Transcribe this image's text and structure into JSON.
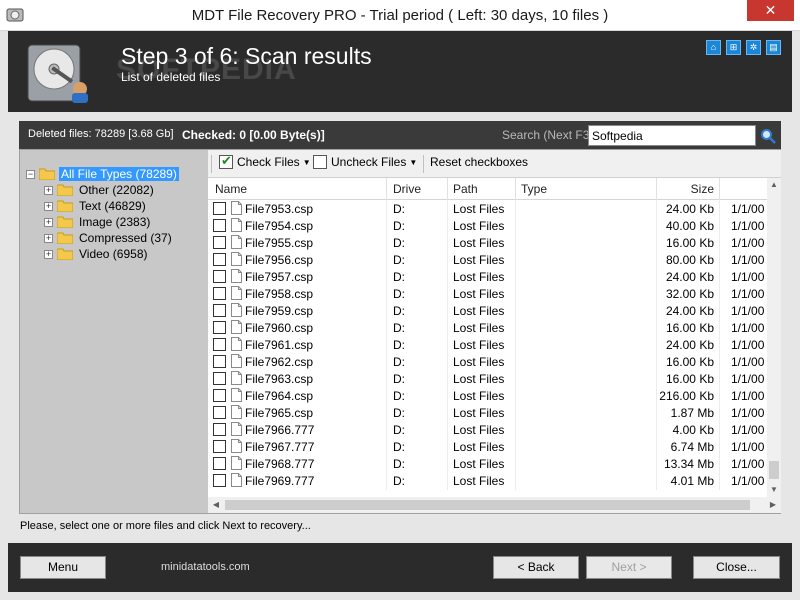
{
  "window": {
    "title": "MDT File Recovery PRO - Trial period ( Left: 30 days, 10 files )",
    "close_glyph": "✕"
  },
  "header": {
    "step": "Step 3 of 6: Scan results",
    "subtitle": "List of deleted files",
    "watermark": "SOFTPEDIA",
    "buttons": [
      {
        "icon": "home-icon",
        "glyph": "⌂"
      },
      {
        "icon": "sitemap-icon",
        "glyph": "⊞"
      },
      {
        "icon": "gear-icon",
        "glyph": "✲"
      },
      {
        "icon": "info-icon",
        "glyph": "▤"
      }
    ]
  },
  "info": {
    "deleted": "Deleted files: 78289 [3.68 Gb]",
    "checked": "Checked: 0 [0.00 Byte(s)]",
    "search_label": "Search (Next F3)",
    "search_value": "Softpedia"
  },
  "tree": {
    "root": {
      "label": "All File Types (78289)",
      "expander": "−"
    },
    "children": [
      {
        "label": "Other (22082)",
        "expander": "+"
      },
      {
        "label": "Text (46829)",
        "expander": "+"
      },
      {
        "label": "Image (2383)",
        "expander": "+"
      },
      {
        "label": "Compressed (37)",
        "expander": "+"
      },
      {
        "label": "Video (6958)",
        "expander": "+"
      }
    ]
  },
  "toolbar": {
    "check_files": "Check Files",
    "uncheck_files": "Uncheck Files",
    "reset": "Reset checkboxes",
    "arrow": "▼",
    "check_mark": "✔"
  },
  "table": {
    "columns": [
      "Name",
      "Drive",
      "Path",
      "Type",
      "Size"
    ],
    "rows": [
      {
        "name": "File7953.csp",
        "drive": "D:",
        "path": "Lost Files",
        "type": "",
        "size": "24.00 Kb",
        "date": "1/1/00"
      },
      {
        "name": "File7954.csp",
        "drive": "D:",
        "path": "Lost Files",
        "type": "",
        "size": "40.00 Kb",
        "date": "1/1/00"
      },
      {
        "name": "File7955.csp",
        "drive": "D:",
        "path": "Lost Files",
        "type": "",
        "size": "16.00 Kb",
        "date": "1/1/00"
      },
      {
        "name": "File7956.csp",
        "drive": "D:",
        "path": "Lost Files",
        "type": "",
        "size": "80.00 Kb",
        "date": "1/1/00"
      },
      {
        "name": "File7957.csp",
        "drive": "D:",
        "path": "Lost Files",
        "type": "",
        "size": "24.00 Kb",
        "date": "1/1/00"
      },
      {
        "name": "File7958.csp",
        "drive": "D:",
        "path": "Lost Files",
        "type": "",
        "size": "32.00 Kb",
        "date": "1/1/00"
      },
      {
        "name": "File7959.csp",
        "drive": "D:",
        "path": "Lost Files",
        "type": "",
        "size": "24.00 Kb",
        "date": "1/1/00"
      },
      {
        "name": "File7960.csp",
        "drive": "D:",
        "path": "Lost Files",
        "type": "",
        "size": "16.00 Kb",
        "date": "1/1/00"
      },
      {
        "name": "File7961.csp",
        "drive": "D:",
        "path": "Lost Files",
        "type": "",
        "size": "24.00 Kb",
        "date": "1/1/00"
      },
      {
        "name": "File7962.csp",
        "drive": "D:",
        "path": "Lost Files",
        "type": "",
        "size": "16.00 Kb",
        "date": "1/1/00"
      },
      {
        "name": "File7963.csp",
        "drive": "D:",
        "path": "Lost Files",
        "type": "",
        "size": "16.00 Kb",
        "date": "1/1/00"
      },
      {
        "name": "File7964.csp",
        "drive": "D:",
        "path": "Lost Files",
        "type": "",
        "size": "216.00 Kb",
        "date": "1/1/00"
      },
      {
        "name": "File7965.csp",
        "drive": "D:",
        "path": "Lost Files",
        "type": "",
        "size": "1.87 Mb",
        "date": "1/1/00"
      },
      {
        "name": "File7966.777",
        "drive": "D:",
        "path": "Lost Files",
        "type": "",
        "size": "4.00 Kb",
        "date": "1/1/00"
      },
      {
        "name": "File7967.777",
        "drive": "D:",
        "path": "Lost Files",
        "type": "",
        "size": "6.74 Mb",
        "date": "1/1/00"
      },
      {
        "name": "File7968.777",
        "drive": "D:",
        "path": "Lost Files",
        "type": "",
        "size": "13.34 Mb",
        "date": "1/1/00"
      },
      {
        "name": "File7969.777",
        "drive": "D:",
        "path": "Lost Files",
        "type": "",
        "size": "4.01 Mb",
        "date": "1/1/00"
      }
    ]
  },
  "status": "Please, select one or more files and click Next to recovery...",
  "footer": {
    "menu": "Menu",
    "site": "minidatatools.com",
    "back": "< Back",
    "next": "Next >",
    "close": "Close..."
  },
  "colors": {
    "accent": "#3399ff",
    "header_bg": "#2b2b2b",
    "close_red": "#c7372f",
    "icon_blue": "#1b86d6"
  }
}
